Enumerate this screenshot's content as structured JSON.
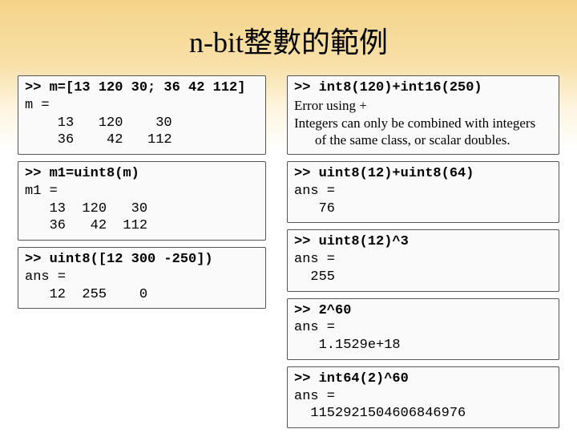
{
  "title": "n-bit整數的範例",
  "left": {
    "box1": {
      "cmd": ">> m=[13 120 30; 36 42 112]",
      "l1": "m =",
      "l2": "    13   120    30",
      "l3": "    36    42   112"
    },
    "box2": {
      "cmd": ">> m1=uint8(m)",
      "l1": "m1 =",
      "l2": "   13  120   30",
      "l3": "   36   42  112"
    },
    "box3": {
      "cmd": ">> uint8([12 300 -250])",
      "l1": "ans =",
      "l2": "   12  255    0"
    }
  },
  "right": {
    "box1": {
      "cmd": ">> int8(120)+int16(250)",
      "l1": "Error using +",
      "l2": "Integers can only be combined with integers",
      "l3": "of the same class, or scalar doubles."
    },
    "box2": {
      "cmd": ">> uint8(12)+uint8(64)",
      "l1": "ans =",
      "l2": "   76"
    },
    "box3": {
      "cmd": ">> uint8(12)^3",
      "l1": "ans =",
      "l2": "  255"
    },
    "box4": {
      "cmd": ">> 2^60",
      "l1": "ans =",
      "l2": "   1.1529e+18"
    },
    "box5": {
      "cmd": ">> int64(2)^60",
      "l1": "ans =",
      "l2": "  1152921504606846976"
    }
  }
}
